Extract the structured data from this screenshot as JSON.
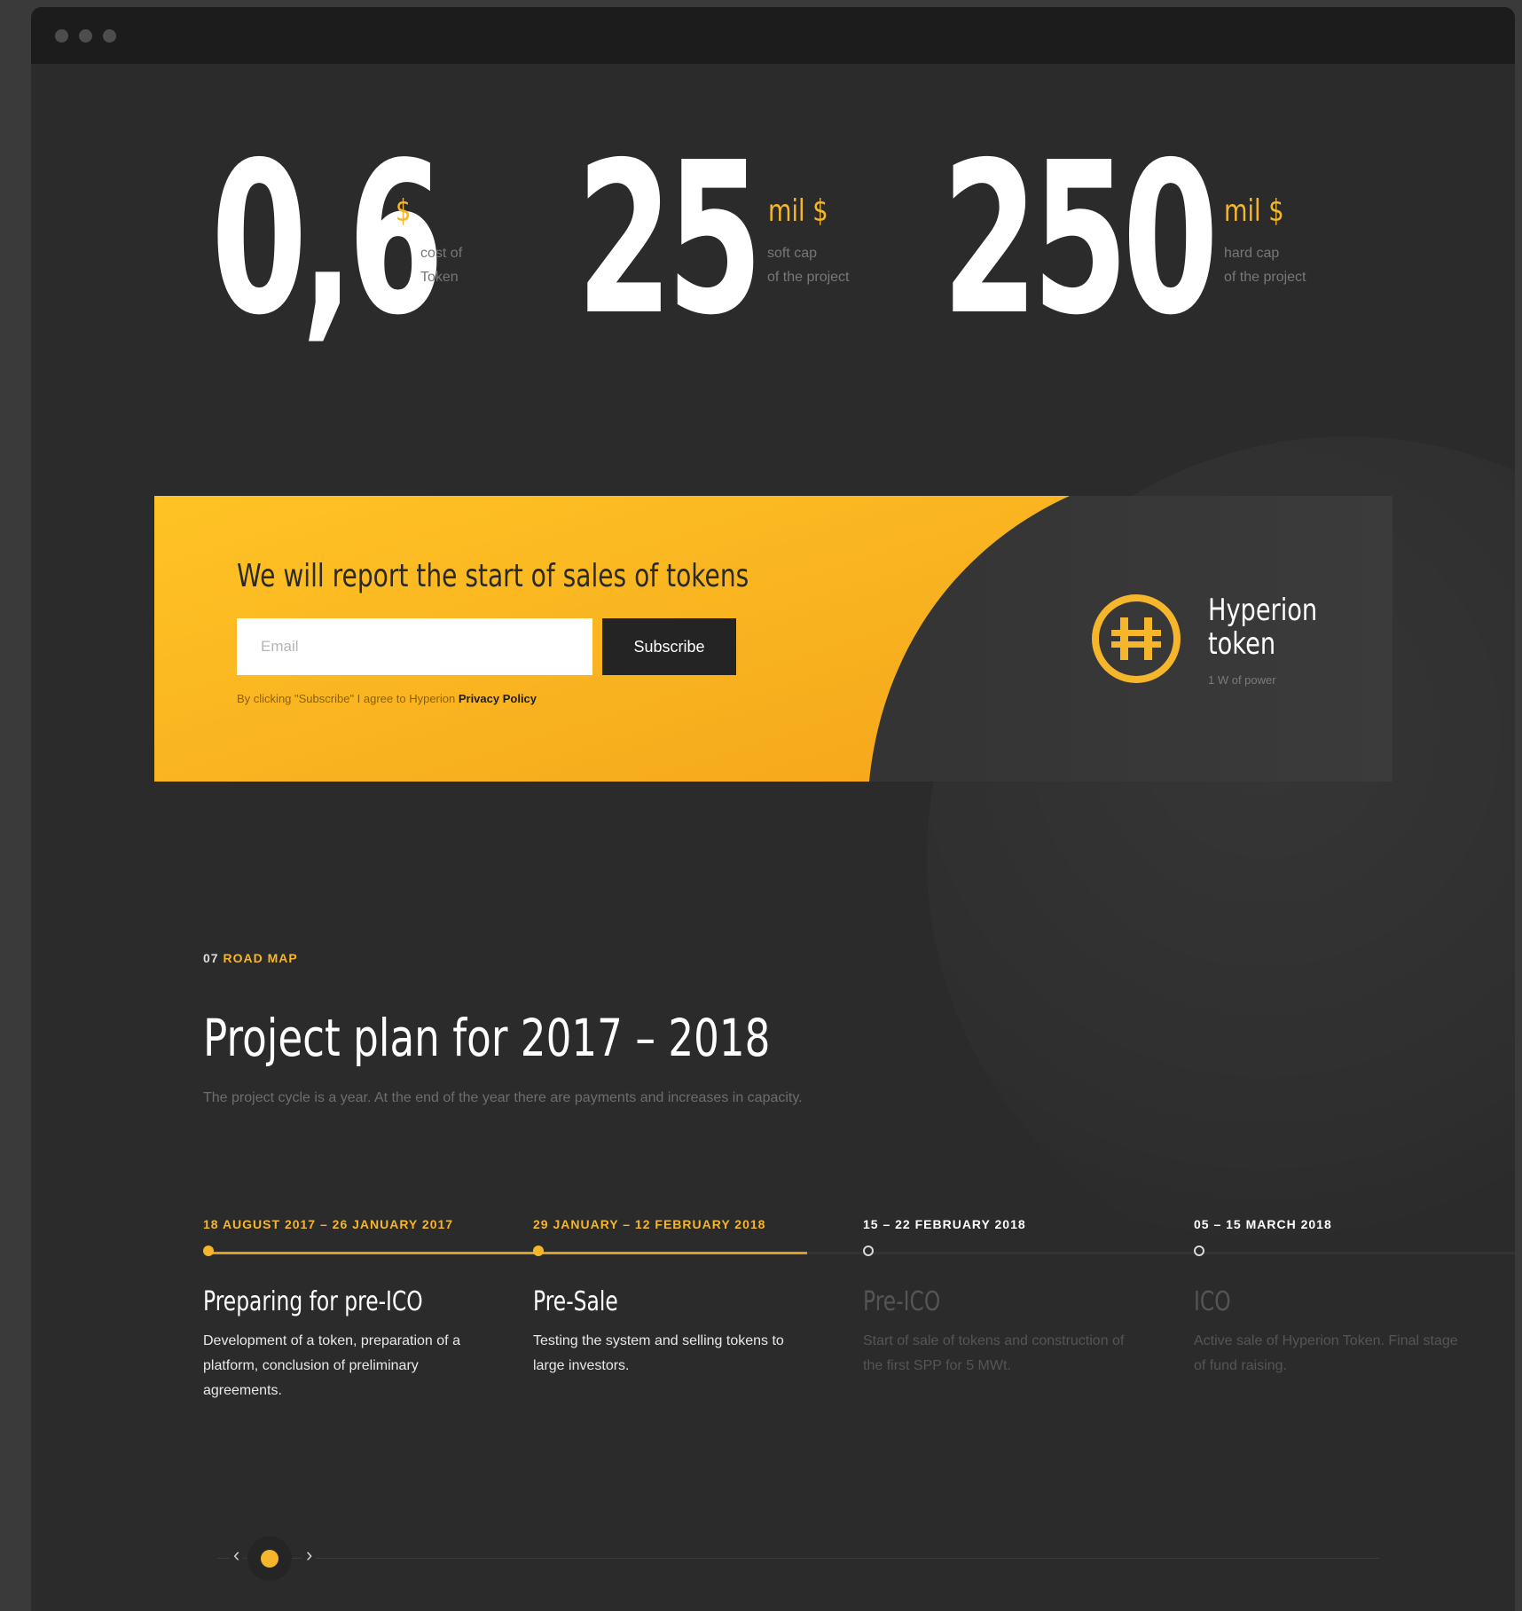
{
  "stats": [
    {
      "value": "0,6",
      "unit": "$",
      "caption": "cost of\nToken"
    },
    {
      "value": "25",
      "unit": "mil $",
      "caption": "soft cap\nof the project"
    },
    {
      "value": "250",
      "unit": "mil $",
      "caption": "hard cap\nof the project"
    }
  ],
  "subscribe": {
    "title": "We will report the start of sales of tokens",
    "email_placeholder": "Email",
    "email_value": "",
    "button_label": "Subscribe",
    "consent_text": "By clicking \"Subscribe\" I agree to Hyperion ",
    "consent_link": "Privacy Policy"
  },
  "token": {
    "name": "Hyperion\ntoken",
    "subtitle": "1 W of power",
    "icon": "hyperion-token-logo"
  },
  "roadmap": {
    "section_number": "07",
    "section_label": "ROAD MAP",
    "title": "Project plan for 2017 – 2018",
    "description": "The project cycle is a year. At the end of the year there are payments and increases in capacity.",
    "milestones": [
      {
        "date": "18 AUGUST 2017 – 26 JANUARY 2017",
        "title": "Preparing for pre-ICO",
        "description": "Development of a token, preparation of a platform, conclusion of preliminary agreements.",
        "status": "done"
      },
      {
        "date": "29 JANUARY – 12 FEBRUARY 2018",
        "title": "Pre-Sale",
        "description": "Testing the system and selling tokens to large investors.",
        "status": "done"
      },
      {
        "date": "15 – 22 FEBRUARY 2018",
        "title": "Pre-ICO",
        "description": "Start of sale of tokens and construction of the first SPP for 5 MWt.",
        "status": "upcoming"
      },
      {
        "date": "05 – 15 MARCH 2018",
        "title": "ICO",
        "description": "Active sale of Hyperion Token. Final stage of fund raising.",
        "status": "upcoming"
      }
    ]
  },
  "slider": {
    "prev_icon": "‹",
    "next_icon": "›"
  },
  "colors": {
    "accent": "#f5b62b",
    "background": "#2b2b2b",
    "titlebar": "#1c1c1c"
  }
}
